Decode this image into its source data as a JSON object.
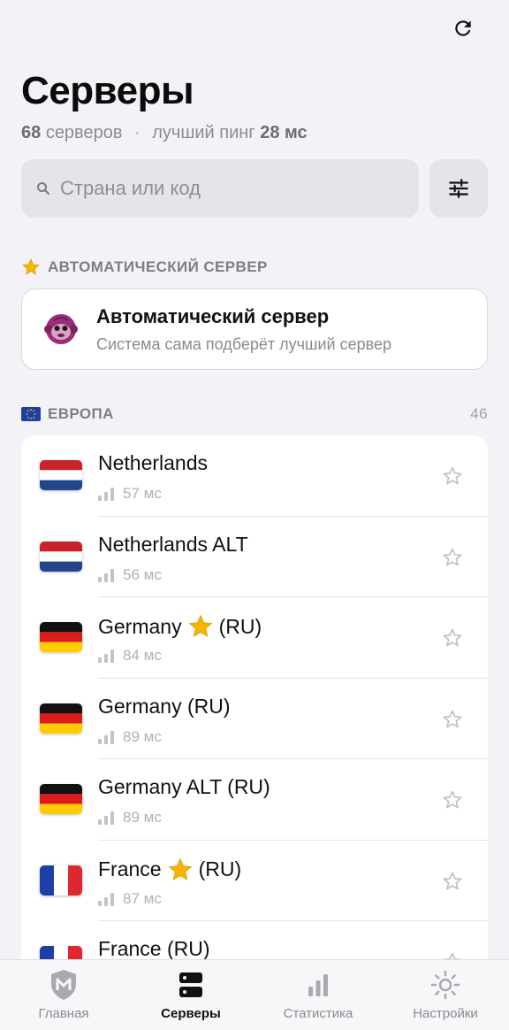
{
  "header": {
    "title": "Серверы",
    "server_count": "68",
    "server_count_label": "серверов",
    "separator": "·",
    "best_ping_label": "лучший пинг",
    "best_ping_value": "28 мс"
  },
  "search": {
    "placeholder": "Страна или код"
  },
  "auto_section": {
    "header": "АВТОМАТИЧЕСКИЙ СЕРВЕР",
    "card_title": "Автоматический сервер",
    "card_subtitle": "Система сама подберёт лучший сервер"
  },
  "europe_section": {
    "header": "ЕВРОПА",
    "count": "46"
  },
  "servers": [
    {
      "name": "Netherlands",
      "featured": false,
      "suffix": "",
      "ping": "57 мс",
      "flag": "nl"
    },
    {
      "name": "Netherlands ALT",
      "featured": false,
      "suffix": "",
      "ping": "56 мс",
      "flag": "nl"
    },
    {
      "name": "Germany",
      "featured": true,
      "suffix": "(RU)",
      "ping": "84 мс",
      "flag": "de"
    },
    {
      "name": "Germany (RU)",
      "featured": false,
      "suffix": "",
      "ping": "89 мс",
      "flag": "de"
    },
    {
      "name": "Germany ALT (RU)",
      "featured": false,
      "suffix": "",
      "ping": "89 мс",
      "flag": "de"
    },
    {
      "name": "France",
      "featured": true,
      "suffix": "(RU)",
      "ping": "87 мс",
      "flag": "fr"
    },
    {
      "name": "France (RU)",
      "featured": false,
      "suffix": "",
      "ping": "",
      "flag": "fr"
    }
  ],
  "tabs": [
    {
      "label": "Главная",
      "icon": "shield-icon",
      "active": false
    },
    {
      "label": "Серверы",
      "icon": "servers-icon",
      "active": true
    },
    {
      "label": "Статистика",
      "icon": "stats-icon",
      "active": false
    },
    {
      "label": "Настройки",
      "icon": "settings-icon",
      "active": false
    }
  ],
  "colors": {
    "background": "#f2f2f7",
    "card": "#ffffff",
    "star_gold": "#f5b400",
    "muted_text": "#8a8a90"
  }
}
